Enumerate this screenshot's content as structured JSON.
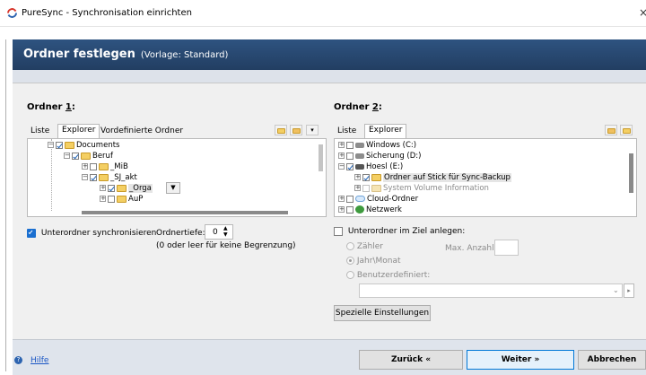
{
  "window": {
    "title": "PureSync - Synchronisation einrichten",
    "close_glyph": "×"
  },
  "banner": {
    "title": "Ordner festlegen",
    "subtitle": "(Vorlage: Standard)"
  },
  "left": {
    "label_prefix": "Ordner ",
    "label_key": "1",
    "label_suffix": ":",
    "tabs": [
      "Liste",
      "Explorer",
      "Vordefinierte Ordner"
    ],
    "tree": [
      {
        "text": "Documents",
        "checked": true
      },
      {
        "text": "Beruf",
        "checked": true
      },
      {
        "text": "_MiB",
        "checked": false
      },
      {
        "text": "_SJ_akt",
        "checked": true
      },
      {
        "text": "_Orga",
        "checked": true
      },
      {
        "text": "AuP",
        "checked": false
      }
    ],
    "sync_subfolders": "Unterordner synchronisieren",
    "depth_label": "Ordnertiefe:",
    "depth_value": "0",
    "depth_hint": "(0 oder leer für keine Begrenzung)"
  },
  "right": {
    "label_prefix": "Ordner ",
    "label_key": "2",
    "label_suffix": ":",
    "tabs": [
      "Liste",
      "Explorer"
    ],
    "tree": [
      {
        "text": "Windows (C:)"
      },
      {
        "text": "Sicherung (D:)"
      },
      {
        "text": "Hoesl (E:)"
      },
      {
        "text": "Ordner auf Stick für Sync-Backup"
      },
      {
        "text": "System Volume Information"
      },
      {
        "text": "Cloud-Ordner"
      },
      {
        "text": "Netzwerk"
      }
    ],
    "create_subfolder": "Unterordner im Ziel anlegen:",
    "radio_counter": "Zähler",
    "max_count_label": "Max. Anzahl:",
    "radio_year_month": "Jahr\\Monat",
    "radio_custom": "Benutzerdefiniert:",
    "special_settings": "Spezielle Einstellungen"
  },
  "footer": {
    "help": "Hilfe",
    "back": "Zurück «",
    "next": "Weiter »",
    "cancel": "Abbrechen"
  }
}
